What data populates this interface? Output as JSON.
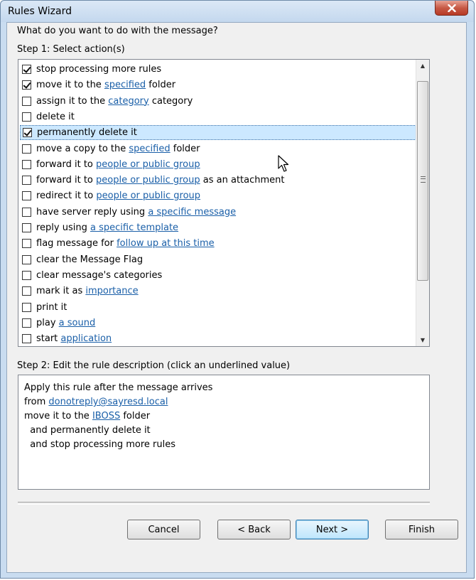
{
  "window": {
    "title": "Rules Wizard"
  },
  "question": "What do you want to do with the message?",
  "step1_label": "Step 1: Select action(s)",
  "actions": [
    {
      "checked": true,
      "selected": false,
      "parts": [
        {
          "t": "stop processing more rules"
        }
      ]
    },
    {
      "checked": true,
      "selected": false,
      "parts": [
        {
          "t": "move it to the "
        },
        {
          "t": "specified",
          "link": true
        },
        {
          "t": " folder"
        }
      ]
    },
    {
      "checked": false,
      "selected": false,
      "parts": [
        {
          "t": "assign it to the "
        },
        {
          "t": "category",
          "link": true
        },
        {
          "t": " category"
        }
      ]
    },
    {
      "checked": false,
      "selected": false,
      "parts": [
        {
          "t": "delete it"
        }
      ]
    },
    {
      "checked": true,
      "selected": true,
      "parts": [
        {
          "t": "permanently delete it"
        }
      ]
    },
    {
      "checked": false,
      "selected": false,
      "parts": [
        {
          "t": "move a copy to the "
        },
        {
          "t": "specified",
          "link": true
        },
        {
          "t": " folder"
        }
      ]
    },
    {
      "checked": false,
      "selected": false,
      "parts": [
        {
          "t": "forward it to "
        },
        {
          "t": "people or public group",
          "link": true
        }
      ]
    },
    {
      "checked": false,
      "selected": false,
      "parts": [
        {
          "t": "forward it to "
        },
        {
          "t": "people or public group",
          "link": true
        },
        {
          "t": " as an attachment"
        }
      ]
    },
    {
      "checked": false,
      "selected": false,
      "parts": [
        {
          "t": "redirect it to "
        },
        {
          "t": "people or public group",
          "link": true
        }
      ]
    },
    {
      "checked": false,
      "selected": false,
      "parts": [
        {
          "t": "have server reply using "
        },
        {
          "t": "a specific message",
          "link": true
        }
      ]
    },
    {
      "checked": false,
      "selected": false,
      "parts": [
        {
          "t": "reply using "
        },
        {
          "t": "a specific template",
          "link": true
        }
      ]
    },
    {
      "checked": false,
      "selected": false,
      "parts": [
        {
          "t": "flag message for "
        },
        {
          "t": "follow up at this time",
          "link": true
        }
      ]
    },
    {
      "checked": false,
      "selected": false,
      "parts": [
        {
          "t": "clear the Message Flag"
        }
      ]
    },
    {
      "checked": false,
      "selected": false,
      "parts": [
        {
          "t": "clear message's categories"
        }
      ]
    },
    {
      "checked": false,
      "selected": false,
      "parts": [
        {
          "t": "mark it as "
        },
        {
          "t": "importance",
          "link": true
        }
      ]
    },
    {
      "checked": false,
      "selected": false,
      "parts": [
        {
          "t": "print it"
        }
      ]
    },
    {
      "checked": false,
      "selected": false,
      "parts": [
        {
          "t": "play "
        },
        {
          "t": "a sound",
          "link": true
        }
      ]
    },
    {
      "checked": false,
      "selected": false,
      "parts": [
        {
          "t": "start "
        },
        {
          "t": "application",
          "link": true
        }
      ]
    }
  ],
  "step2_label": "Step 2: Edit the rule description (click an underlined value)",
  "description": [
    {
      "parts": [
        {
          "t": "Apply this rule after the message arrives"
        }
      ]
    },
    {
      "parts": [
        {
          "t": "from "
        },
        {
          "t": "donotreply@sayresd.local",
          "link": true
        }
      ]
    },
    {
      "parts": [
        {
          "t": "move it to the "
        },
        {
          "t": "IBOSS",
          "link": true
        },
        {
          "t": " folder"
        }
      ]
    },
    {
      "parts": [
        {
          "t": "  and permanently delete it"
        }
      ]
    },
    {
      "parts": [
        {
          "t": "  and stop processing more rules"
        }
      ]
    }
  ],
  "buttons": {
    "cancel": "Cancel",
    "back": "< Back",
    "next": "Next >",
    "finish": "Finish"
  },
  "colors": {
    "link": "#1a5fa8",
    "selection": "#cce8ff",
    "close_button": "#c75a46"
  },
  "icons": {
    "close": "close-icon",
    "scroll_up": "scroll-up-arrow-icon",
    "scroll_down": "scroll-down-arrow-icon",
    "cursor": "mouse-pointer-icon"
  }
}
